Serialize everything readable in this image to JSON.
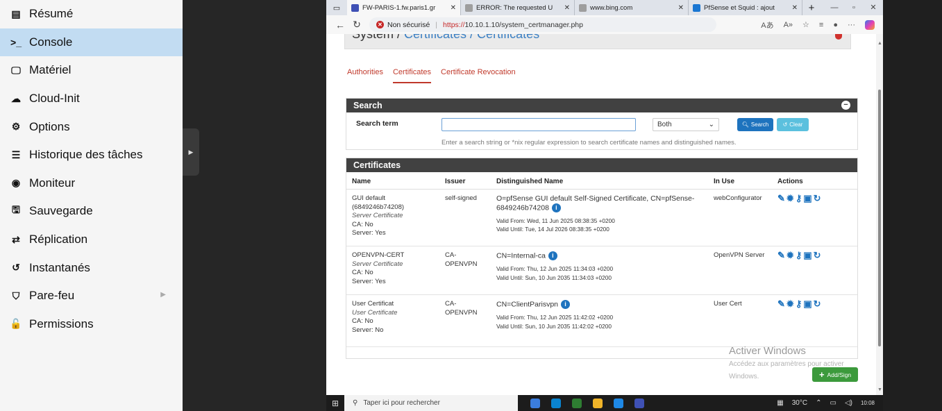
{
  "sidebar": {
    "items": [
      {
        "icon": "document-icon",
        "glyph": "▤",
        "label": "Résumé"
      },
      {
        "icon": "terminal-icon",
        "glyph": ">_",
        "label": "Console",
        "active": true
      },
      {
        "icon": "monitor-icon",
        "glyph": "🖵",
        "label": "Matériel"
      },
      {
        "icon": "cloud-icon",
        "glyph": "☁",
        "label": "Cloud-Init"
      },
      {
        "icon": "gear-icon",
        "glyph": "⚙",
        "label": "Options"
      },
      {
        "icon": "list-icon",
        "glyph": "☰",
        "label": "Historique des tâches"
      },
      {
        "icon": "eye-icon",
        "glyph": "◉",
        "label": "Moniteur"
      },
      {
        "icon": "floppy-icon",
        "glyph": "🖫",
        "label": "Sauvegarde"
      },
      {
        "icon": "retweet-icon",
        "glyph": "⇄",
        "label": "Réplication"
      },
      {
        "icon": "history-icon",
        "glyph": "↺",
        "label": "Instantanés"
      },
      {
        "icon": "shield-icon",
        "glyph": "⛉",
        "label": "Pare-feu",
        "submenu": true
      },
      {
        "icon": "unlock-icon",
        "glyph": "🔓",
        "label": "Permissions"
      }
    ]
  },
  "browser": {
    "tabs": [
      {
        "title": "FW-PARIS-1.fw.paris1.gr",
        "color": "#3f51b5",
        "active": true
      },
      {
        "title": "ERROR: The requested U",
        "color": "#9e9e9e"
      },
      {
        "title": "www.bing.com",
        "color": "#9e9e9e"
      },
      {
        "title": "PfSense et Squid : ajout",
        "color": "#1976d2"
      }
    ],
    "security_label": "Non sécurisé",
    "url_scheme": "https://",
    "url_rest": "10.10.1.10/system_certmanager.php",
    "reader_label": "Aあ"
  },
  "pf": {
    "breadcrumb_prefix": "System /",
    "breadcrumb_links": "Certificates / Certificates",
    "subtabs": [
      "Authorities",
      "Certificates",
      "Certificate Revocation"
    ],
    "active_subtab": 1,
    "search": {
      "title": "Search",
      "label": "Search term",
      "value": "",
      "select_value": "Both",
      "search_btn": "Search",
      "clear_btn": "Clear",
      "help": "Enter a search string or *nix regular expression to search certificate names and distinguished names."
    },
    "certs": {
      "title": "Certificates",
      "columns": [
        "Name",
        "Issuer",
        "Distinguished Name",
        "In Use",
        "Actions"
      ],
      "rows": [
        {
          "name": [
            "GUI default",
            "(6849246b74208)"
          ],
          "type": "Server Certificate",
          "ca": "CA: No",
          "server": "Server: Yes",
          "issuer": [
            "self-signed"
          ],
          "dn": [
            "O=pfSense GUI default Self-Signed Certificate, CN=pfSense-",
            "6849246b74208"
          ],
          "valid_from": "Valid From: Wed, 11 Jun 2025 08:38:35 +0200",
          "valid_until": "Valid Until: Tue, 14 Jul 2026 08:38:35 +0200",
          "in_use": "webConfigurator"
        },
        {
          "name": [
            "OPENVPN-CERT"
          ],
          "type": "Server Certificate",
          "ca": "CA: No",
          "server": "Server: Yes",
          "issuer": [
            "CA-",
            "OPENVPN"
          ],
          "dn": [
            "CN=Internal-ca"
          ],
          "valid_from": "Valid From: Thu, 12 Jun 2025 11:34:03 +0200",
          "valid_until": "Valid Until: Sun, 10 Jun 2035 11:34:03 +0200",
          "in_use": "OpenVPN Server"
        },
        {
          "name": [
            "User Certificat"
          ],
          "type": "User Certificate",
          "ca": "CA: No",
          "server": "Server: No",
          "issuer": [
            "CA-",
            "OPENVPN"
          ],
          "dn": [
            "CN=ClientParisvpn"
          ],
          "valid_from": "Valid From: Thu, 12 Jun 2025 11:42:02 +0200",
          "valid_until": "Valid Until: Sun, 10 Jun 2035 11:42:02 +0200",
          "in_use": "User Cert"
        }
      ]
    },
    "add_sign": "Add/Sign"
  },
  "watermark": {
    "title": "Activer Windows",
    "line1": "Accédez aux paramètres pour activer",
    "line2": "Windows."
  },
  "taskbar": {
    "search_placeholder": "Taper ici pour rechercher",
    "temperature": "30°C",
    "time": "10:08",
    "apps": [
      "#3b7ddd",
      "#0a84d0",
      "#2e7d32",
      "#f0b429",
      "#1e88e5",
      "#3f51b5"
    ]
  }
}
